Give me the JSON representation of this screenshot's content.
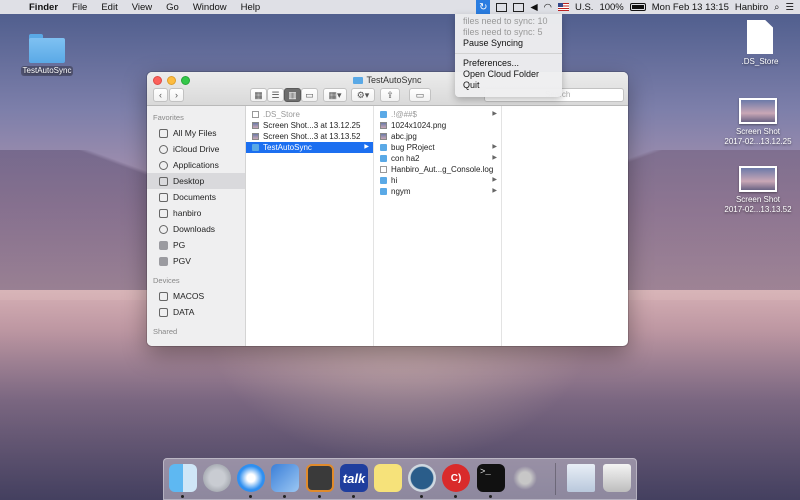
{
  "menubar": {
    "apple": "",
    "app_name": "Finder",
    "items": [
      "File",
      "Edit",
      "View",
      "Go",
      "Window",
      "Help"
    ],
    "status": {
      "sync_icon": "↻",
      "input_source": "U.S.",
      "battery": "100%",
      "clock": "Mon Feb 13  13:15",
      "user": "Hanbiro"
    }
  },
  "sync_menu": {
    "status_lines": [
      "files need to sync: 10",
      "files need to sync: 5"
    ],
    "pause": "Pause Syncing",
    "preferences": "Preferences...",
    "open_folder": "Open Cloud Folder",
    "quit": "Quit"
  },
  "desktop": {
    "left_icon": "TestAutoSync",
    "right_icons": [
      {
        "label": ".DS_Store"
      },
      {
        "label": "Screen Shot\n2017-02...13.12.25"
      },
      {
        "label": "Screen Shot\n2017-02...13.13.52"
      }
    ]
  },
  "finder": {
    "title": "TestAutoSync",
    "search_placeholder": "Search",
    "sidebar": {
      "favorites_header": "Favorites",
      "favorites": [
        "All My Files",
        "iCloud Drive",
        "Applications",
        "Desktop",
        "Documents",
        "hanbiro",
        "Downloads",
        "PG",
        "PGV"
      ],
      "devices_header": "Devices",
      "devices": [
        "MACOS",
        "DATA"
      ],
      "shared_header": "Shared"
    },
    "column1": [
      {
        "name": ".DS_Store",
        "kind": "file",
        "dim": true
      },
      {
        "name": "Screen Shot...3 at 13.12.25",
        "kind": "img"
      },
      {
        "name": "Screen Shot...3 at 13.13.52",
        "kind": "img"
      },
      {
        "name": "TestAutoSync",
        "kind": "folder",
        "selected": true
      }
    ],
    "column2": [
      {
        "name": ".!@##$",
        "kind": "folder",
        "dim": true,
        "arrow": true
      },
      {
        "name": "1024x1024.png",
        "kind": "img"
      },
      {
        "name": "abc.jpg",
        "kind": "img"
      },
      {
        "name": "bug PRoject",
        "kind": "folder",
        "arrow": true
      },
      {
        "name": "con ha2",
        "kind": "folder",
        "arrow": true
      },
      {
        "name": "Hanbiro_Aut...g_Console.log",
        "kind": "file"
      },
      {
        "name": "hi",
        "kind": "folder",
        "arrow": true
      },
      {
        "name": "ngym",
        "kind": "folder",
        "arrow": true
      }
    ]
  },
  "dock": {
    "apps": [
      "Finder",
      "Launchpad",
      "Safari",
      "Xcode",
      "Sublime Text",
      "talk",
      "Stickies",
      "SourceTree",
      "Cloud",
      "Terminal",
      "Keychain",
      "Preview",
      "Trash"
    ],
    "talk_label": "talk",
    "cloud_label": "C)",
    "terminal_label": ">_"
  }
}
